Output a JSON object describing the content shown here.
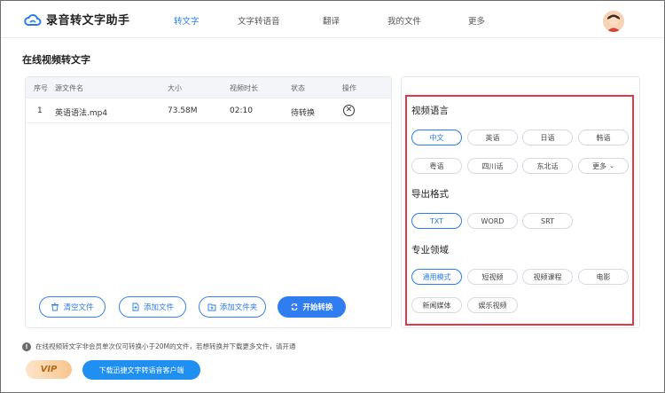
{
  "app": {
    "name": "录音转文字助手"
  },
  "nav": {
    "items": [
      "转文字",
      "文字转语音",
      "翻译",
      "我的文件",
      "更多"
    ],
    "active": "转文字"
  },
  "page": {
    "title": "在线视频转文字"
  },
  "table": {
    "headers": [
      "序号",
      "源文件名",
      "大小",
      "视频时长",
      "状态",
      "操作"
    ],
    "rows": [
      {
        "index": "1",
        "name": "英语语法.mp4",
        "size": "73.58M",
        "duration": "02:10",
        "status": "待转换",
        "action": "⊗"
      }
    ]
  },
  "buttons": {
    "clear": "清空文件",
    "add_file": "添加文件",
    "add_folder": "添加文件夹",
    "start": "开始转换"
  },
  "settings": {
    "language": {
      "title": "视频语言",
      "options": [
        "中文",
        "英语",
        "日语",
        "韩语",
        "粤语",
        "四川话",
        "东北话",
        "更多"
      ],
      "selected": "中文"
    },
    "format": {
      "title": "导出格式",
      "options": [
        "TXT",
        "WORD",
        "SRT"
      ],
      "selected": "TXT"
    },
    "domain": {
      "title": "专业领域",
      "options": [
        "通用模式",
        "短视频",
        "视频课程",
        "电影",
        "新闻媒体",
        "娱乐视频"
      ],
      "selected": "通用模式"
    }
  },
  "footer": {
    "notice": "在线视频转文字非会员单次仅可转换小于20M的文件，若想转换并下载更多文件，请开通",
    "vip": "VIP",
    "download": "下载迅捷文字转语音客户端"
  },
  "colors": {
    "accent": "#2b7de9",
    "primary_button": "#2f7df0",
    "highlight": "#e03a4a"
  }
}
